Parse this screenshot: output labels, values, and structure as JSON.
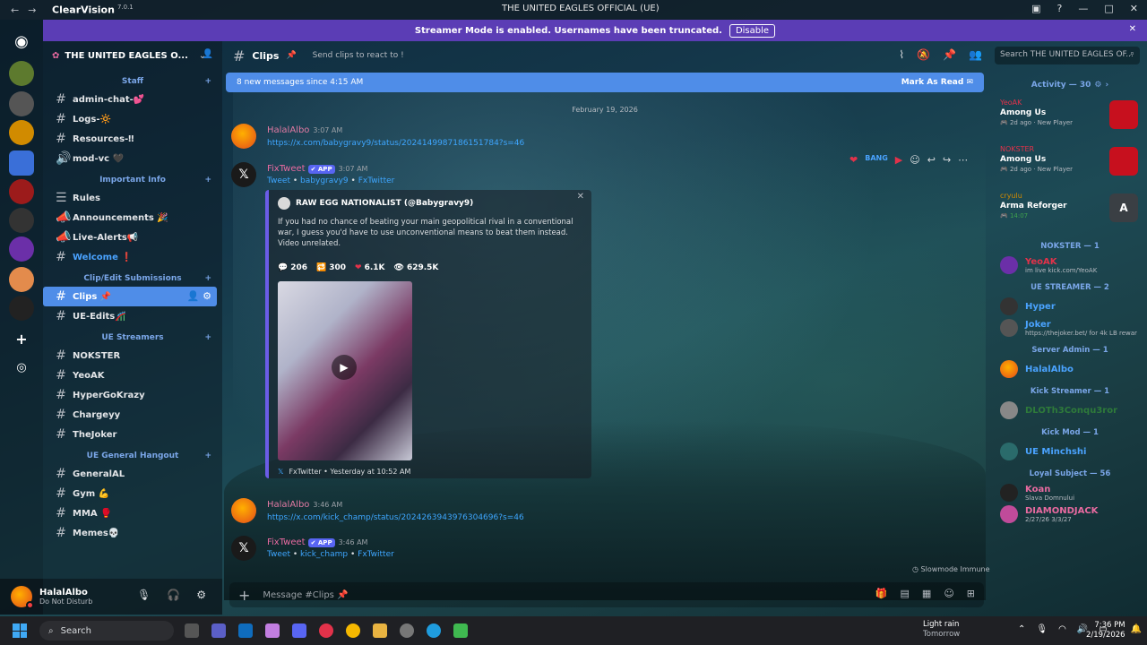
{
  "titlebar": {
    "app": "ClearVision",
    "version": "7.0.1",
    "window_title": "THE UNITED EAGLES OFFICIAL (UE)"
  },
  "banner": {
    "text": "Streamer Mode is enabled. Usernames have been truncated.",
    "button": "Disable"
  },
  "server": {
    "name": "THE UNITED EAGLES O..."
  },
  "categories": {
    "staff": "Staff",
    "important": "Important Info",
    "clip": "Clip/Edit Submissions",
    "streamers": "UE Streamers",
    "hangout": "UE General Hangout"
  },
  "channels": {
    "staff": [
      "admin-chat-💕",
      "Logs-🔆",
      "Resources-‼",
      "mod-vc 🖤"
    ],
    "important": [
      "Rules",
      "Announcements 🎉",
      "Live-Alerts📢",
      "Welcome ❗"
    ],
    "clip": [
      "Clips 📌",
      "UE-Edits🎢"
    ],
    "streamers": [
      "NOKSTER",
      "YeoAK",
      "HyperGoKrazy",
      "Chargeyy",
      "TheJoker"
    ],
    "hangout": [
      "GeneralAL",
      "Gym 💪",
      "MMA 🥊",
      "Memes💀"
    ]
  },
  "user": {
    "name": "HalalAlbo",
    "status": "Do Not Disturb"
  },
  "chat": {
    "channel": "Clips",
    "topic": "Send clips to react to !",
    "search_placeholder": "Search THE UNITED EAGLES OF...",
    "new_messages": "8 new messages since 4:15 AM",
    "mark_read": "Mark As Read",
    "date": "February 19, 2026",
    "composer_placeholder": "Message #Clips 📌",
    "slowmode": "Slowmode Immune"
  },
  "messages": [
    {
      "author": "HalalAlbo",
      "time": "3:07 AM",
      "link": "https://x.com/babygravy9/status/2024149987186151784?s=46"
    },
    {
      "author": "FixTweet",
      "tag": "APP",
      "time": "3:07 AM",
      "sub_a": "Tweet",
      "sub_b": "babygravy9",
      "sub_c": "FxTwitter"
    },
    {
      "author": "HalalAlbo",
      "time": "3:46 AM",
      "link": "https://x.com/kick_champ/status/2024263943976304696?s=46"
    },
    {
      "author": "FixTweet",
      "tag": "APP",
      "time": "3:46 AM",
      "sub_a": "Tweet",
      "sub_b": "kick_champ",
      "sub_c": "FxTwitter"
    }
  ],
  "embed": {
    "author": "RAW EGG NATIONALIST (@Babygravy9)",
    "text": "If you had no chance of beating your main geopolitical rival in a conventional war, I guess you'd have to use unconventional means to beat them instead. Video unrelated.",
    "replies": "206",
    "retweets": "300",
    "likes": "6.1K",
    "views": "629.5K",
    "footer": "FxTwitter • Yesterday at 10:52 AM"
  },
  "activity": {
    "title": "Activity — 30",
    "items": [
      {
        "who": "YeoAK",
        "game": "Among Us",
        "time": "2d ago",
        "status": "New Player"
      },
      {
        "who": "NOKSTER",
        "game": "Among Us",
        "time": "2d ago",
        "status": "New Player"
      },
      {
        "who": "cryulu",
        "game": "Arma Reforger",
        "time": "14:07",
        "status": ""
      }
    ]
  },
  "member_groups": [
    {
      "title": "NOKSTER — 1",
      "members": [
        {
          "name": "YeoAK",
          "status": "im live kick.com/YeoAK",
          "color": "#e2324a"
        }
      ]
    },
    {
      "title": "UE STREAMER — 2",
      "members": [
        {
          "name": "Hyper",
          "status": "",
          "color": "#4aa3ff"
        },
        {
          "name": "Joker",
          "status": "https://thejoker.bet/ for 4k LB rewar",
          "color": "#4aa3ff"
        }
      ]
    },
    {
      "title": "Server Admin — 1",
      "members": [
        {
          "name": "HalalAlbo",
          "status": "",
          "color": "#4aa3ff"
        }
      ]
    },
    {
      "title": "Kick Streamer — 1",
      "members": [
        {
          "name": "DLOTh3Conqu3ror",
          "status": "",
          "color": "#3fa34d"
        }
      ]
    },
    {
      "title": "Kick Mod — 1",
      "members": [
        {
          "name": "UE Minchshi",
          "status": "",
          "color": "#4aa3ff"
        }
      ]
    },
    {
      "title": "Loyal Subject — 56",
      "members": [
        {
          "name": "Koan",
          "status": "Slava Domnului",
          "color": "#e86aa0"
        },
        {
          "name": "DIAMONDJACK",
          "status": "2/27/26 3/3/27",
          "color": "#e86aa0"
        }
      ]
    }
  ],
  "taskbar": {
    "search": "Search",
    "weather": "Light rain",
    "weather_sub": "Tomorrow",
    "time": "7:36 PM",
    "date": "2/19/2026"
  }
}
